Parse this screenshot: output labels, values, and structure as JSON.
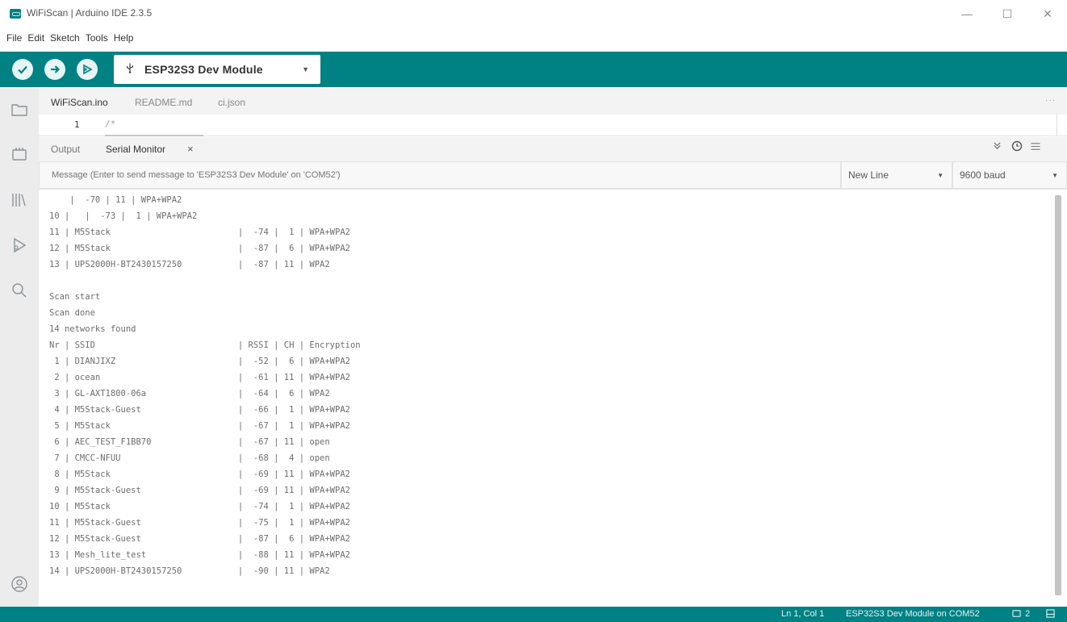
{
  "window": {
    "title": "WiFiScan | Arduino IDE 2.3.5",
    "controls": {
      "minimize": "—",
      "maximize": "☐",
      "close": "✕"
    }
  },
  "menu": [
    "File",
    "Edit",
    "Sketch",
    "Tools",
    "Help"
  ],
  "toolbar": {
    "verify_icon": "check-icon",
    "upload_icon": "arrow-right-icon",
    "debug_icon": "debug-icon",
    "board_name": "ESP32S3 Dev Module",
    "serial_plotter_icon": "plotter-icon",
    "serial_monitor_icon": "serial-monitor-icon"
  },
  "sidebar": [
    "folder-icon",
    "boards-icon",
    "library-icon",
    "debug-icon",
    "search-icon",
    "account-icon"
  ],
  "file_tabs": [
    {
      "label": "WiFiScan.ino",
      "active": true
    },
    {
      "label": "README.md",
      "active": false
    },
    {
      "label": "ci.json",
      "active": false
    }
  ],
  "file_tabs_more": "···",
  "editor": {
    "line_number": "1",
    "line_text": "/*"
  },
  "panel": {
    "tabs": [
      {
        "label": "Output",
        "active": false
      },
      {
        "label": "Serial Monitor",
        "active": true
      }
    ],
    "close_label": "×"
  },
  "serial": {
    "message_placeholder": "Message (Enter to send message to 'ESP32S3 Dev Module' on 'COM52')",
    "line_ending": "New Line",
    "baud": "9600 baud",
    "output_lines": [
      "    |  -70 | 11 | WPA+WPA2",
      "10 |   |  -73 |  1 | WPA+WPA2",
      "11 | M5Stack                         |  -74 |  1 | WPA+WPA2",
      "12 | M5Stack                         |  -87 |  6 | WPA+WPA2",
      "13 | UPS2000H-BT2430157250           |  -87 | 11 | WPA2",
      "",
      "Scan start",
      "Scan done",
      "14 networks found",
      "Nr | SSID                            | RSSI | CH | Encryption",
      " 1 | DIANJIXZ                        |  -52 |  6 | WPA+WPA2",
      " 2 | ocean                           |  -61 | 11 | WPA+WPA2",
      " 3 | GL-AXT1800-06a                  |  -64 |  6 | WPA2",
      " 4 | M5Stack-Guest                   |  -66 |  1 | WPA+WPA2",
      " 5 | M5Stack                         |  -67 |  1 | WPA+WPA2",
      " 6 | AEC_TEST_F1BB70                 |  -67 | 11 | open",
      " 7 | CMCC-NFUU                       |  -68 |  4 | open",
      " 8 | M5Stack                         |  -69 | 11 | WPA+WPA2",
      " 9 | M5Stack-Guest                   |  -69 | 11 | WPA+WPA2",
      "10 | M5Stack                         |  -74 |  1 | WPA+WPA2",
      "11 | M5Stack-Guest                   |  -75 |  1 | WPA+WPA2",
      "12 | M5Stack-Guest                   |  -87 |  6 | WPA+WPA2",
      "13 | Mesh_lite_test                  |  -88 | 11 | WPA+WPA2",
      "14 | UPS2000H-BT2430157250           |  -90 | 11 | WPA2"
    ]
  },
  "status": {
    "position": "Ln 1, Col 1",
    "board_port": "ESP32S3 Dev Module on COM52",
    "notifications": "2"
  },
  "colors": {
    "accent": "#008184",
    "highlight": "#e0312c"
  }
}
